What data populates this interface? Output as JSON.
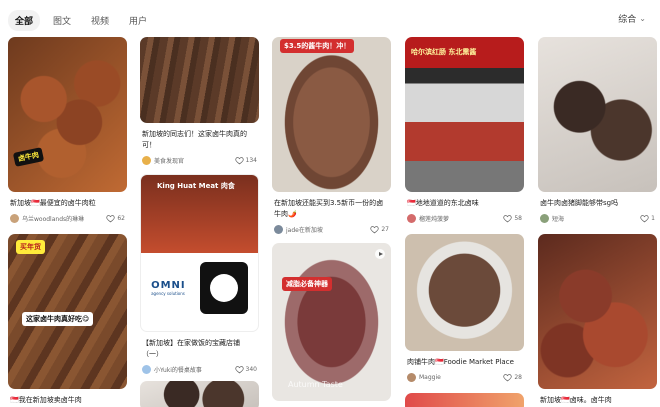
{
  "tabs": [
    {
      "label": "全部",
      "active": true
    },
    {
      "label": "图文",
      "active": false
    },
    {
      "label": "视频",
      "active": false
    },
    {
      "label": "用户",
      "active": false
    }
  ],
  "sort": {
    "label": "综合"
  },
  "cards": {
    "c1": {
      "title": "新加坡🇸🇬最便宜的卤牛肉粒",
      "author": "乌兰woodlands的琳琳",
      "likes": "62",
      "overlay": "卤牛肉"
    },
    "c2": {
      "title": "新加坡的同志们！这家卤牛肉真的可！",
      "author": "美食发现官",
      "likes": "134"
    },
    "c3": {
      "title": "在新加坡还能买到3.5新币一份的卤牛肉🌶️",
      "author": "jade在新加坡",
      "likes": "27",
      "overlay": "$3.5的酱牛肉！冲！"
    },
    "c4": {
      "title": "🇸🇬地地道道的东北卤味",
      "author": "榴莲炖菠萝",
      "likes": "58",
      "overlay": "哈尔滨红肠 东北熏酱"
    },
    "c5": {
      "title": "卤牛肉卤猪脚能够带sg吗",
      "author": "短海",
      "likes": "1"
    },
    "c6": {
      "title": "这家卤牛肉真好吃😋",
      "overlay_top": "买年货",
      "overlay_mid": "这家卤牛肉真好吃😋"
    },
    "c7": {
      "title": "【新加坡】在家做饭的宝藏店铺（一）",
      "author": "小Yuki的餐桌故事",
      "likes": "340",
      "overlay_top": "King Huat Meat 肉食",
      "omni": "OMNI",
      "omni_sub": "agency solutions"
    },
    "c8": {
      "title": "",
      "overlay": "减脂必备神器",
      "watermark": "Autumn Taste"
    },
    "c9": {
      "title": "肉铺牛肉🇸🇬Foodie Market Place",
      "author": "Maggie",
      "likes": "28"
    },
    "c10": {
      "title": "🇸🇬我在新加坡卖卤牛肉"
    },
    "c11": {
      "title": "新加坡🇸🇬卤味。卤牛肉"
    }
  },
  "colors": {
    "accent": "#d32f2f",
    "tab_active_bg": "#f2f2f2"
  }
}
